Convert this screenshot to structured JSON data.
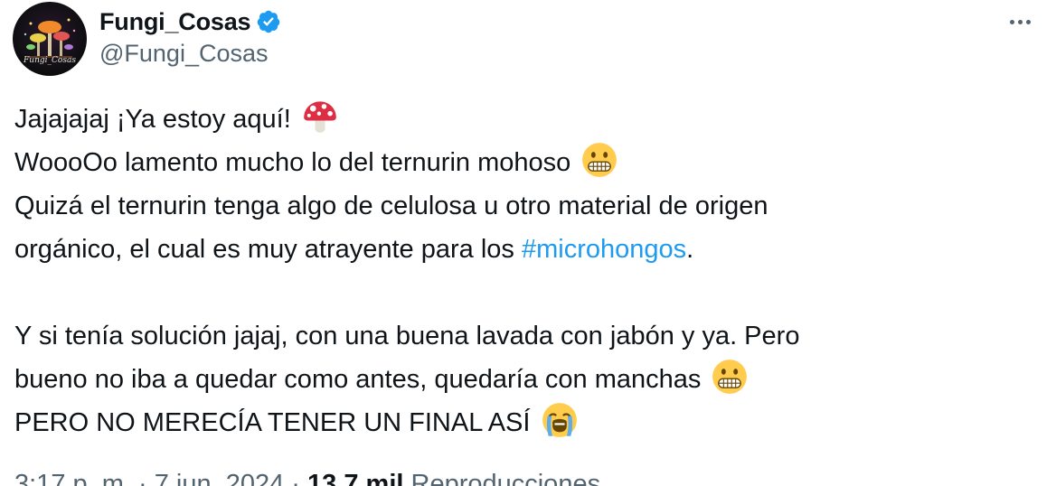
{
  "author": {
    "display_name": "Fungi_Cosas",
    "handle": "@Fungi_Cosas",
    "avatar_text": "Fungi_Cosas",
    "verified_icon": "verified-badge-icon",
    "verified_color": "#1d9bf0"
  },
  "menu": {
    "icon": "more-options-icon"
  },
  "tweet": {
    "line1": "Jajajajaj ¡Ya estoy aquí!",
    "line2": "WoooOo lamento mucho lo del ternurin mohoso",
    "line3": "Quizá el ternurin tenga algo de celulosa u otro material de origen",
    "line4_before": "orgánico, el cual es muy atrayente para los ",
    "line4_hashtag": "#microhongos",
    "line4_after": ".",
    "line5": "Y si tenía solución jajaj, con una buena lavada con jabón y ya. Pero",
    "line6": "bueno no iba a quedar como antes, quedaría con manchas",
    "line7": "PERO NO MERECÍA TENER UN FINAL ASÍ",
    "emoji_icons": [
      "mushroom-emoji-icon",
      "grimacing-face-emoji-icon",
      "grimacing-face-emoji-icon",
      "loudly-crying-face-emoji-icon"
    ]
  },
  "meta": {
    "time": "3:17 p. m. · 7 jun. 2024",
    "views_count": "13,7 mil",
    "views_label": "Reproducciones"
  },
  "colors": {
    "text": "#0f1419",
    "secondary": "#536471",
    "link": "#1d9bf0"
  }
}
